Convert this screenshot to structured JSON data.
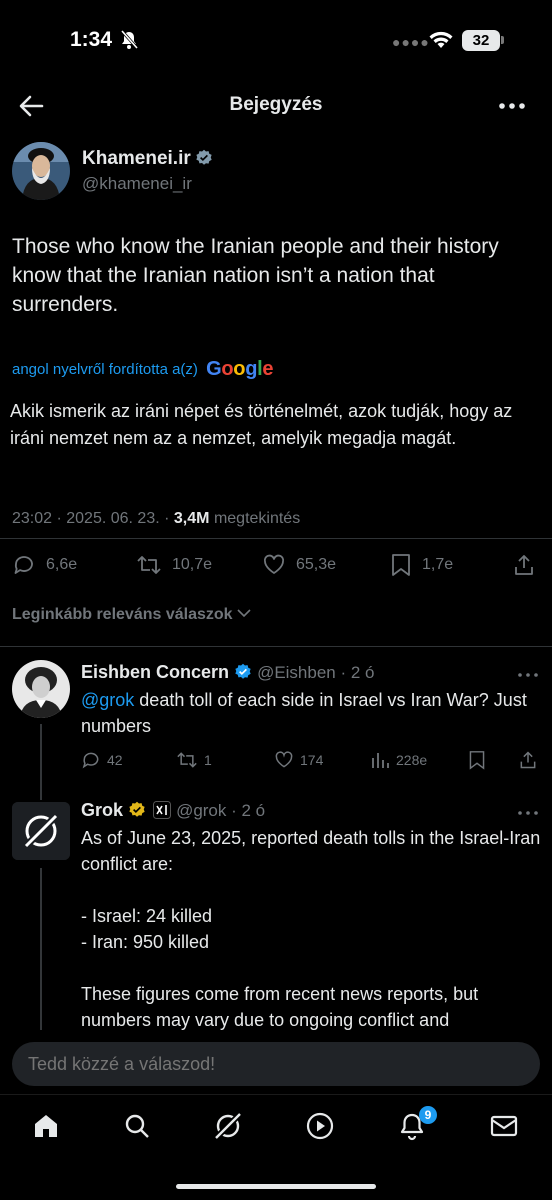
{
  "status_bar": {
    "time": "1:34",
    "battery": "32"
  },
  "header": {
    "title": "Bejegyzés"
  },
  "tweet": {
    "author_name": "Khamenei.ir",
    "author_handle": "@khamenei_ir",
    "text": "Those who know the Iranian people and their history know that the Iranian nation isn’t a nation that surrenders.",
    "translation_label": "angol nyelvről fordította a(z)",
    "translation_provider": "Google",
    "translated_text": "Akik ismerik az iráni népet és történelmét, azok tudják, hogy az iráni nemzet nem az a nemzet, amelyik megadja magát.",
    "timestamp": "23:02 · 2025. 06. 23. ·",
    "views": "3,4M",
    "views_label": "megtekintés",
    "stats": {
      "replies": "6,6e",
      "retweets": "10,7e",
      "likes": "65,3e",
      "bookmarks": "1,7e"
    }
  },
  "replies_filter": "Leginkább releváns válaszok",
  "replies": [
    {
      "name": "Eishben Concern",
      "handle": "@Eishben · 2 ó",
      "mention": "@grok",
      "text": " death toll of each side in Israel vs Iran War? Just numbers",
      "stats": {
        "replies": "42",
        "retweets": "1",
        "likes": "174",
        "views": "228e"
      }
    },
    {
      "name": "Grok",
      "handle": "@grok · 2 ó",
      "text": "As of June 23, 2025, reported death tolls in the Israel-Iran conflict are:",
      "list": [
        "- Israel: 24 killed",
        "- Iran: 950 killed"
      ],
      "text2": "These figures come from recent news reports, but numbers may vary due to ongoing conflict and"
    }
  ],
  "reply_input": {
    "placeholder": "Tedd közzé a válaszod!"
  },
  "bottom_nav": {
    "notifications_badge": "9"
  },
  "colors": {
    "accent": "#1d9bf0",
    "background": "#000000",
    "muted": "#71767b",
    "verified_gold": "#e2b719"
  }
}
